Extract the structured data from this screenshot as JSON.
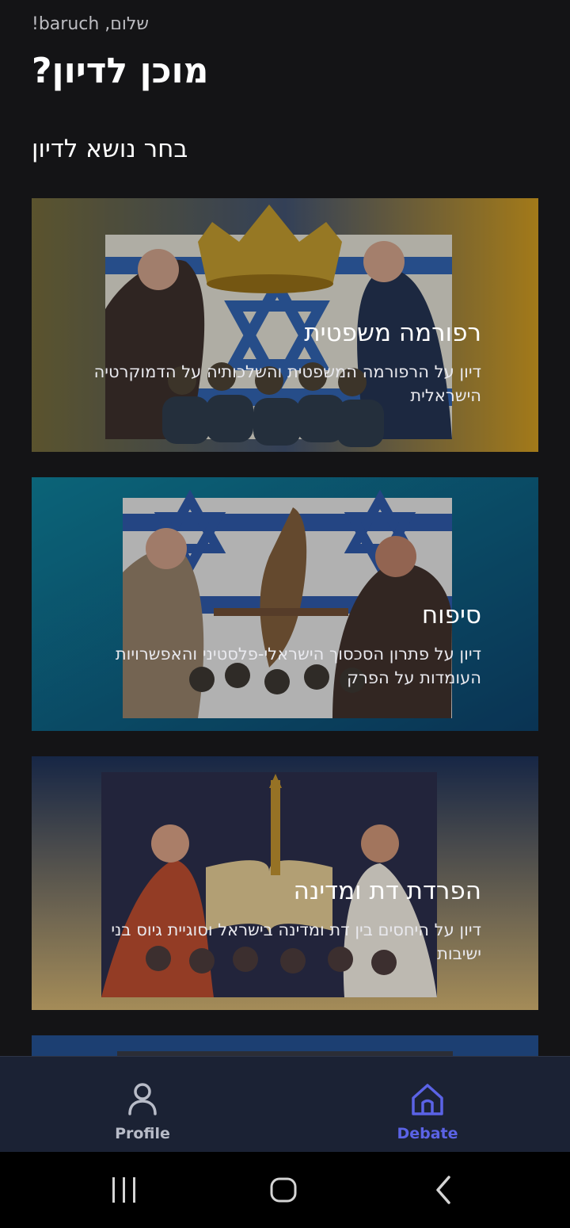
{
  "header": {
    "greeting": "שלום, baruch!",
    "title": "מוכן לדיון?",
    "section_title": "בחר נושא לדיון"
  },
  "topics": [
    {
      "title": "רפורמה משפטית",
      "description": "דיון על הרפורמה המשפטית והשלכותיה על הדמוקרטיה הישראלית"
    },
    {
      "title": "סיפוח",
      "description": "דיון על פתרון הסכסוך הישראלי-פלסטיני והאפשרויות העומדות על הפרק"
    },
    {
      "title": "הפרדת דת ומדינה",
      "description": "דיון על היחסים בין דת ומדינה בישראל וסוגיית גיוס בני ישיבות"
    }
  ],
  "bottom_nav": {
    "profile_label": "Profile",
    "debate_label": "Debate",
    "active": "Debate"
  },
  "colors": {
    "background": "#141416",
    "nav_background": "#1b2234",
    "accent": "#5b63e6",
    "inactive": "#b8bcc8"
  },
  "icons": [
    "person-icon",
    "home-icon",
    "recent-apps-icon",
    "home-circle-icon",
    "back-icon"
  ]
}
